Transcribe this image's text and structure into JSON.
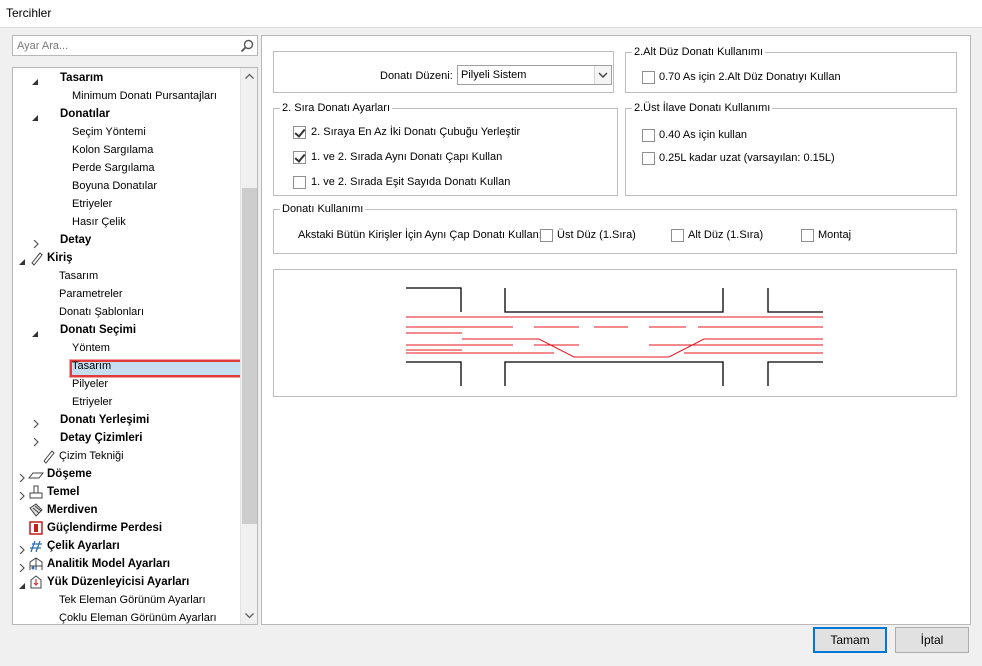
{
  "window": {
    "title": "Tercihler"
  },
  "search": {
    "placeholder": "Ayar Ara..."
  },
  "tree": {
    "items": [
      {
        "label": "Tasarım",
        "bold": true
      },
      {
        "label": "Minimum Donatı Pursantajları",
        "bold": false
      },
      {
        "label": "Donatılar",
        "bold": true
      },
      {
        "label": "Seçim Yöntemi",
        "bold": false
      },
      {
        "label": "Kolon Sargılama",
        "bold": false
      },
      {
        "label": "Perde Sargılama",
        "bold": false
      },
      {
        "label": "Boyuna Donatılar",
        "bold": false
      },
      {
        "label": "Etriyeler",
        "bold": false
      },
      {
        "label": "Hasır Çelik",
        "bold": false
      },
      {
        "label": "Detay",
        "bold": true
      },
      {
        "label": "Kiriş",
        "bold": true
      },
      {
        "label": "Tasarım",
        "bold": false
      },
      {
        "label": "Parametreler",
        "bold": false
      },
      {
        "label": "Donatı Şablonları",
        "bold": false
      },
      {
        "label": "Donatı Seçimi",
        "bold": true
      },
      {
        "label": "Yöntem",
        "bold": false
      },
      {
        "label": "Tasarım",
        "bold": false,
        "selected": true
      },
      {
        "label": "Pilyeler",
        "bold": false
      },
      {
        "label": "Etriyeler",
        "bold": false
      },
      {
        "label": "Donatı Yerleşimi",
        "bold": true
      },
      {
        "label": "Detay Çizimleri",
        "bold": true
      },
      {
        "label": "Çizim Tekniği",
        "bold": false
      },
      {
        "label": "Döşeme",
        "bold": true
      },
      {
        "label": "Temel",
        "bold": true
      },
      {
        "label": "Merdiven",
        "bold": true
      },
      {
        "label": "Güçlendirme Perdesi",
        "bold": true
      },
      {
        "label": "Çelik Ayarları",
        "bold": true
      },
      {
        "label": "Analitik Model Ayarları",
        "bold": true
      },
      {
        "label": "Yük Düzenleyicisi Ayarları",
        "bold": true
      },
      {
        "label": "Tek Eleman Görünüm Ayarları",
        "bold": false
      },
      {
        "label": "Çoklu Eleman Görünüm Ayarları",
        "bold": false
      }
    ]
  },
  "arrangement": {
    "label": "Donatı Düzeni:",
    "value": "Pilyeli Sistem"
  },
  "bottom_second_row": {
    "legend": "2.Alt Düz Donatı Kullanımı",
    "option": {
      "label": "0.70 As için 2.Alt Düz Donatıyı Kullan",
      "checked": false
    }
  },
  "second_row": {
    "legend": "2. Sıra Donatı Ayarları",
    "options": [
      {
        "label": "2. Sıraya En Az İki Donatı Çubuğu Yerleştir",
        "checked": true
      },
      {
        "label": "1. ve 2. Sırada Aynı Donatı Çapı Kullan",
        "checked": true
      },
      {
        "label": "1. ve 2. Sırada Eşit Sayıda Donatı Kullan",
        "checked": false
      }
    ]
  },
  "top_extra": {
    "legend": "2.Üst İlave Donatı Kullanımı",
    "options": [
      {
        "label": "0.40 As için kullan",
        "checked": false
      },
      {
        "label": "0.25L kadar uzat (varsayılan: 0.15L)",
        "checked": false
      }
    ]
  },
  "usage": {
    "legend": "Donatı Kullanımı",
    "label": "Akstaki Bütün Kirişler İçin Aynı Çap Donatı Kullan:",
    "options": [
      {
        "label": "Üst Düz (1.Sıra)",
        "checked": false
      },
      {
        "label": "Alt Düz (1.Sıra)",
        "checked": false
      },
      {
        "label": "Montaj",
        "checked": false
      }
    ]
  },
  "buttons": {
    "ok": "Tamam",
    "cancel": "İptal"
  },
  "colors": {
    "rebar": "#e8141c",
    "selection": "#c6dff0",
    "highlight": "#e13a3a"
  }
}
